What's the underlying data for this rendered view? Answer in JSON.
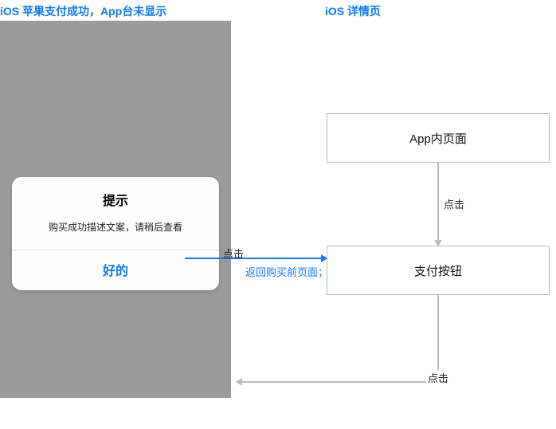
{
  "headings": {
    "left": "iOS 苹果支付成功，App台未显示",
    "right": "iOS 详情页"
  },
  "alert": {
    "title": "提示",
    "body": "购买成功描述文案，请稍后查看",
    "button": "好的"
  },
  "flow": {
    "box_app_page": "App内页面",
    "box_pay_button": "支付按钮",
    "label_click_down1": "点击",
    "label_click_horiz": "点击",
    "label_return": "返回购买前页面；",
    "label_click_down2": "点击"
  }
}
